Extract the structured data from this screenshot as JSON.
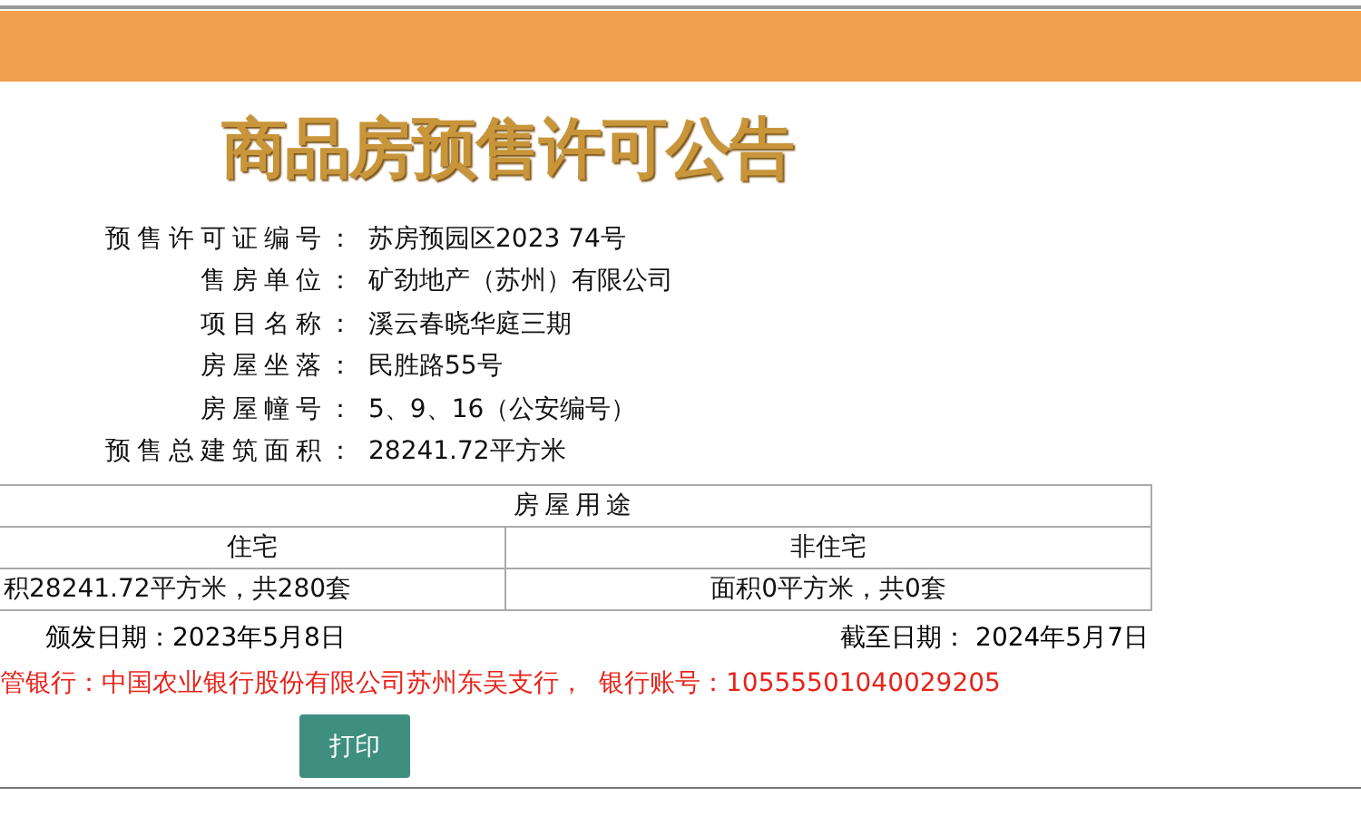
{
  "title": "商品房预售许可公告",
  "fields": [
    {
      "label": "预售许可证编号：",
      "value": "苏房预园区2023 74号"
    },
    {
      "label": "售房单位：",
      "value": "矿劲地产（苏州）有限公司"
    },
    {
      "label": "项目名称：",
      "value": "溪云春晓华庭三期"
    },
    {
      "label": "房屋坐落：",
      "value": "民胜路55号"
    },
    {
      "label": "房屋幢号：",
      "value": "5、9、16（公安编号）"
    },
    {
      "label": "预售总建筑面积：",
      "value": "28241.72平方米"
    }
  ],
  "usage_table": {
    "heading": "房屋用途",
    "columns": [
      "住宅",
      "非住宅"
    ],
    "cells": [
      "积28241.72平方米，共280套",
      "面积0平方米，共0套"
    ]
  },
  "issue_date": "颁发日期：2023年5月8日",
  "expiry_date": "截至日期： 2024年5月7日",
  "bank_line": "管银行：中国农业银行股份有限公司苏州东吴支行，",
  "account_line": "银行账号：10555501040029205",
  "print_button": "打印"
}
